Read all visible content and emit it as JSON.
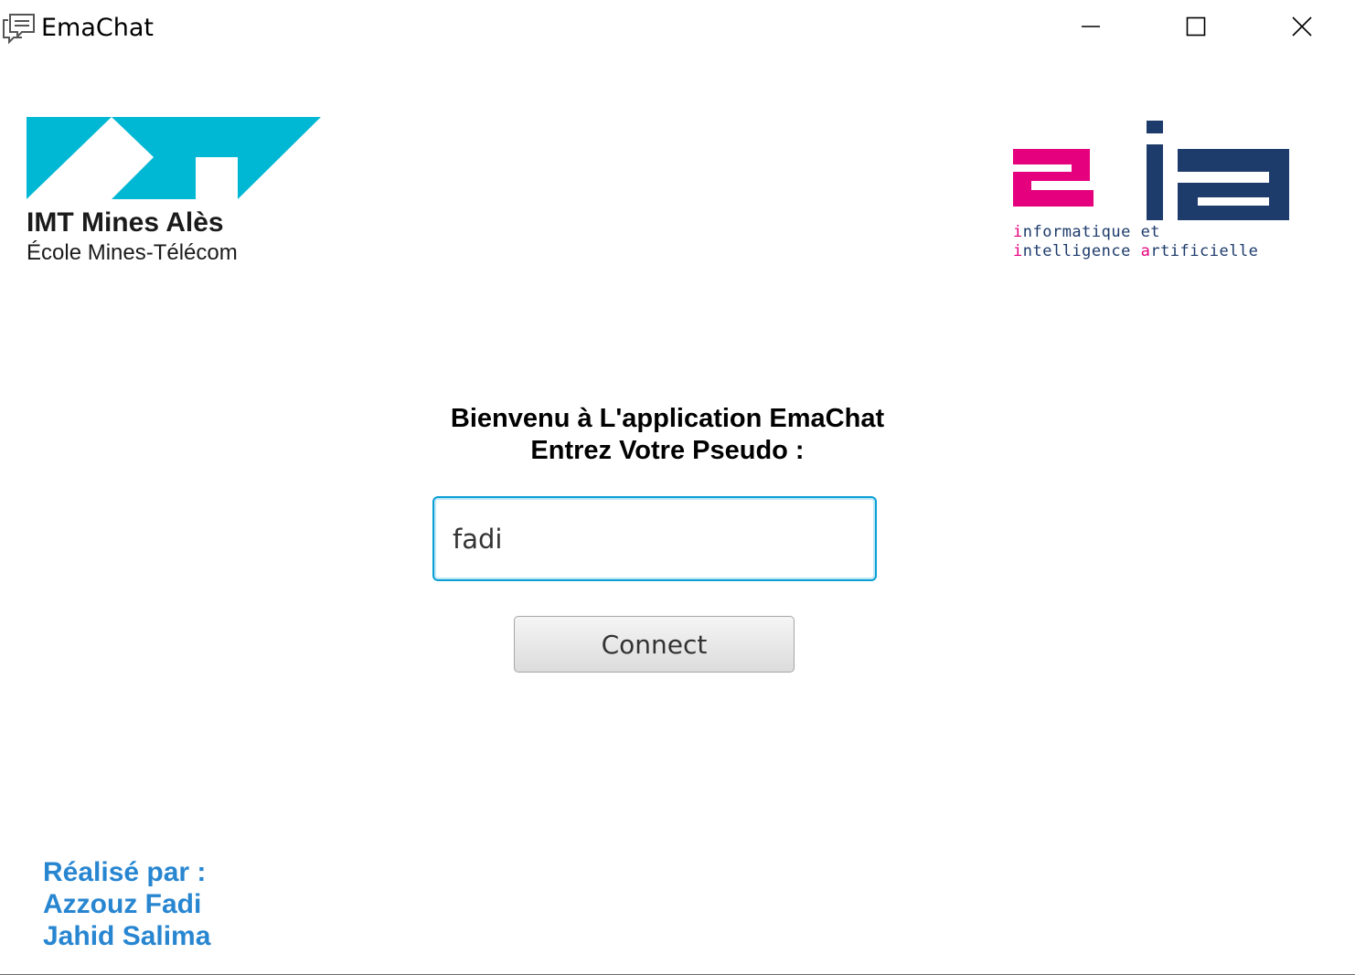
{
  "window": {
    "title": "EmaChat",
    "icon": "chat-bubbles-icon",
    "controls": {
      "minimize_icon": "minimize-icon",
      "maximize_icon": "maximize-icon",
      "close_icon": "close-icon"
    }
  },
  "logos": {
    "imt": {
      "name": "IMT Mines Alès",
      "subtitle": "École Mines-Télécom",
      "color": "#00b8d4"
    },
    "ia": {
      "line1_prefix": "i",
      "line1_rest": "nformatique et",
      "line2_prefix": "i",
      "line2_middle": "ntelligence ",
      "line2_a": "a",
      "line2_rest": "rtificielle",
      "pink": "#e5007e",
      "navy": "#1d3b6b"
    }
  },
  "main": {
    "welcome_line1": "Bienvenu à L'application EmaChat",
    "welcome_line2": "Entrez Votre Pseudo :",
    "pseudo_value": "fadi",
    "connect_label": "Connect"
  },
  "credits": {
    "heading": "Réalisé par :",
    "authors": [
      "Azzouz Fadi",
      "Jahid Salima"
    ],
    "color": "#2886d1"
  }
}
